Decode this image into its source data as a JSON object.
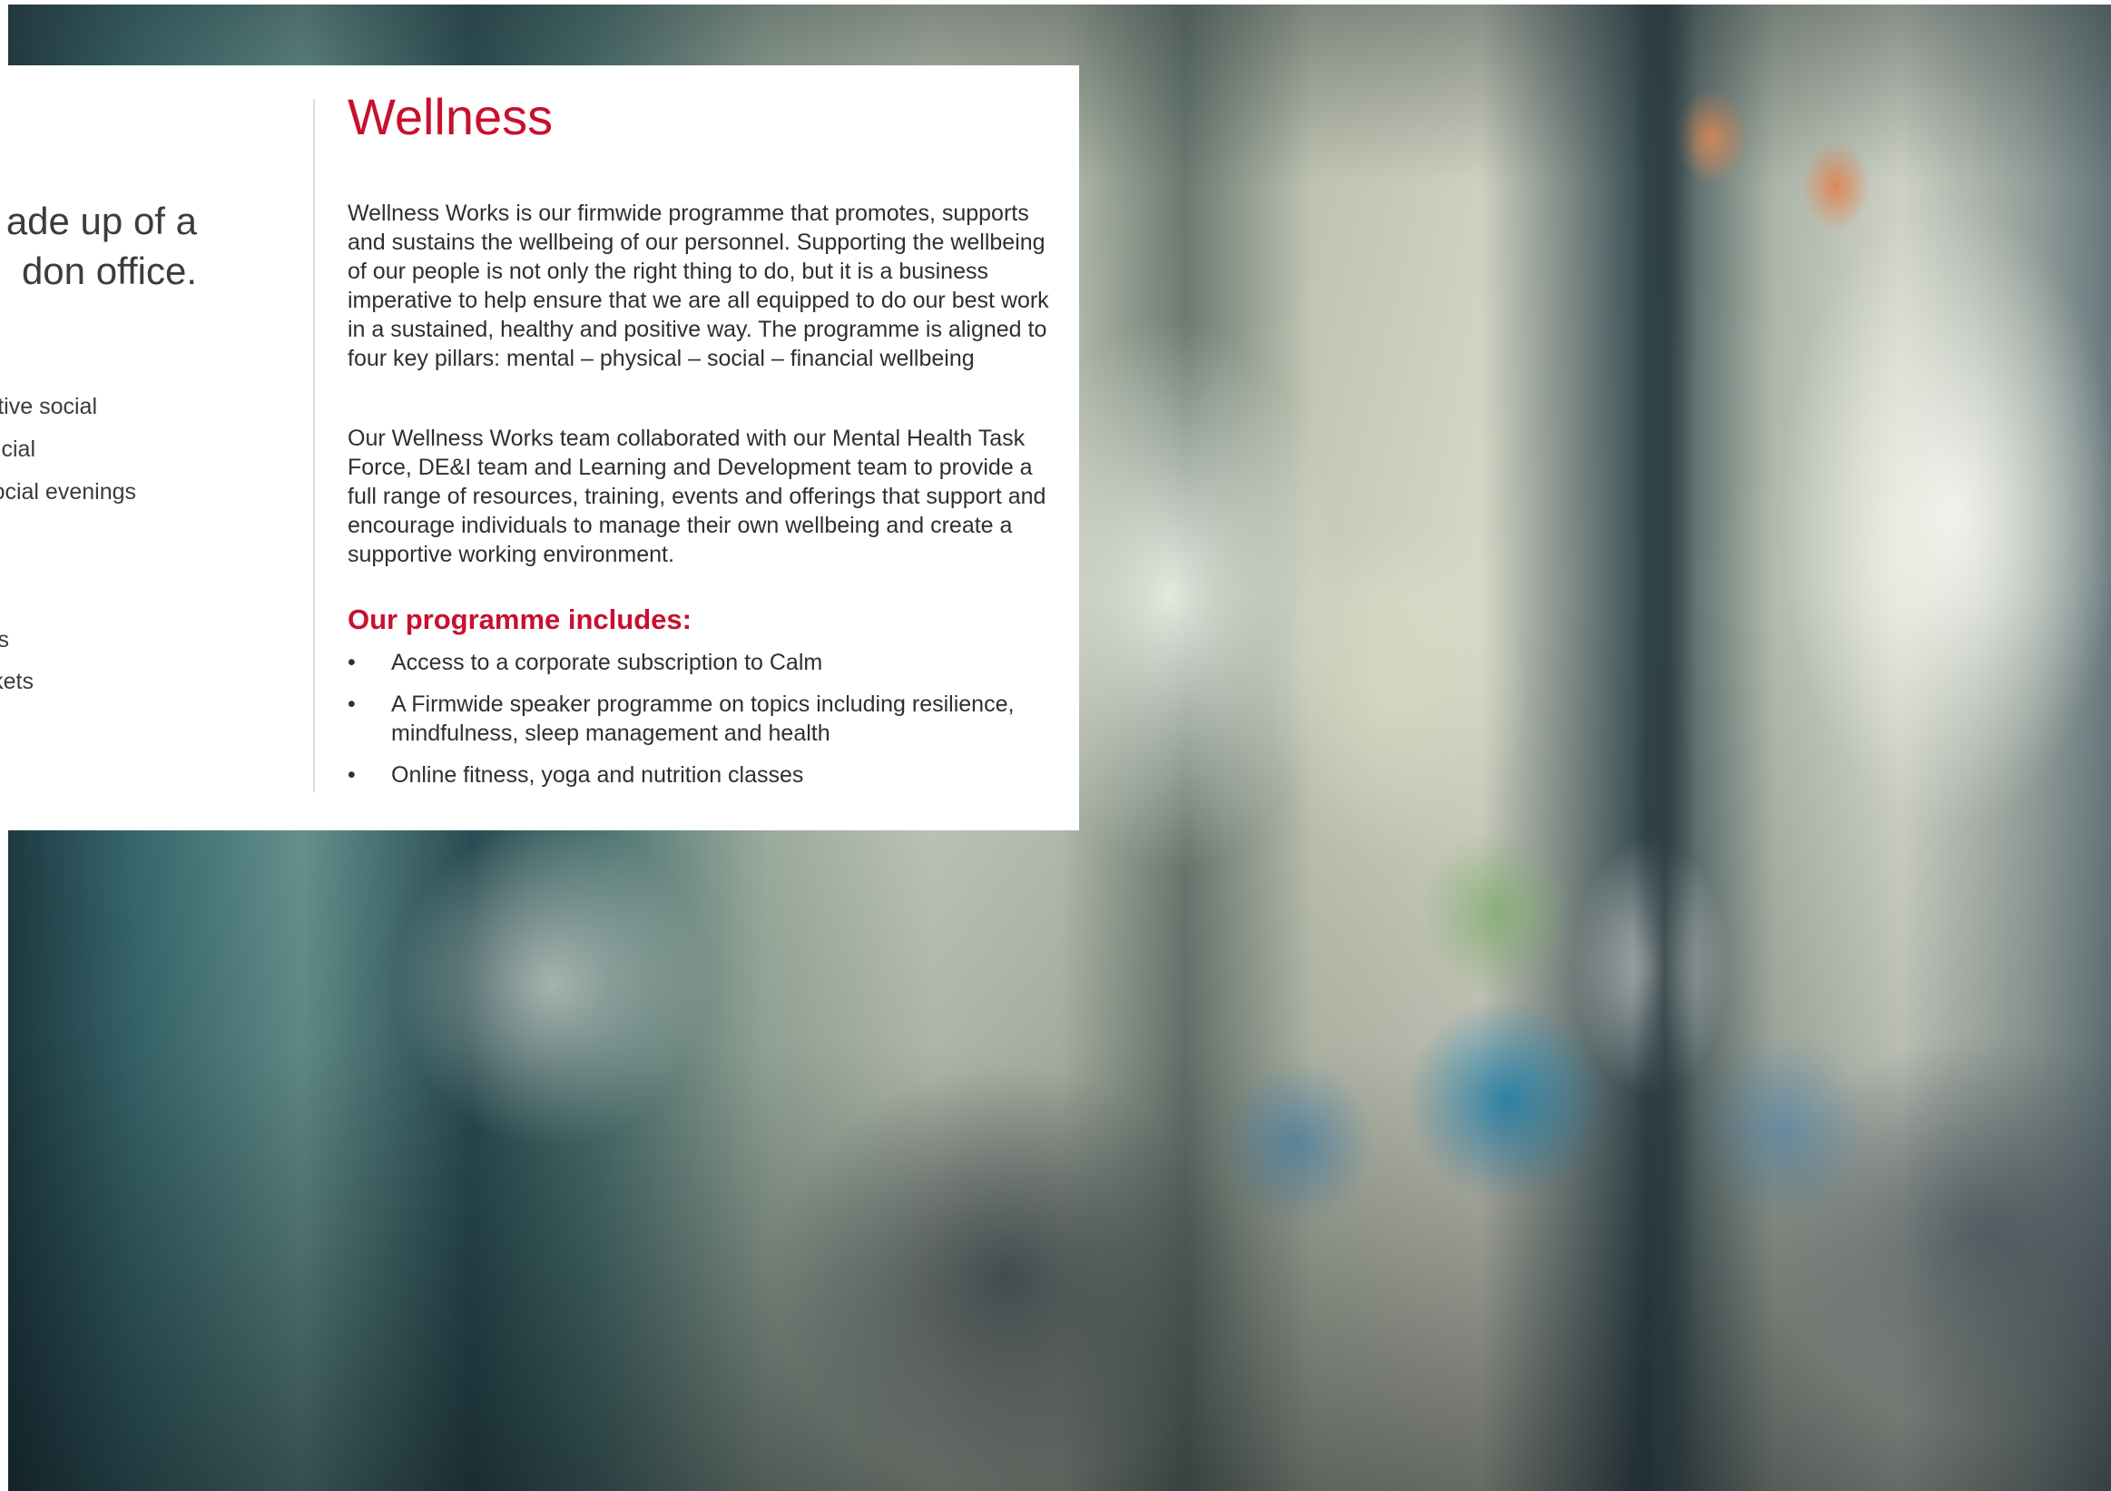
{
  "left_column": {
    "lead_lines": [
      "ade up of a",
      "don office."
    ],
    "items": [
      "tive social",
      "cial",
      "ocial evenings",
      "s",
      "kets"
    ]
  },
  "wellness": {
    "title": "Wellness",
    "paragraphs": [
      "Wellness Works is our firmwide programme that promotes, supports and sustains the wellbeing of our personnel. Supporting the wellbeing of our people is not only the right thing to do, but it is a business imperative to help ensure that we are all equipped to do our best work in a sustained, healthy and positive way. The programme is aligned to four key pillars: mental – physical – social – financial wellbeing",
      "Our Wellness Works team collaborated with our Mental Health Task Force, DE&I team and Learning and Development team to provide a full range of resources, training, events and offerings that support and encourage individuals to manage their own wellbeing and create a supportive working environment."
    ],
    "programme_heading": "Our programme includes:",
    "bullet_glyph": "•",
    "bullets": [
      "Access to a corporate subscription to Calm",
      "A Firmwide speaker programme on topics including resilience, mindfulness, sleep management and health",
      "Online fitness, yoga and nutrition classes"
    ]
  },
  "colors": {
    "accent_red": "#c8102e",
    "body_text": "#2f2f2f",
    "divider": "#dedede"
  }
}
